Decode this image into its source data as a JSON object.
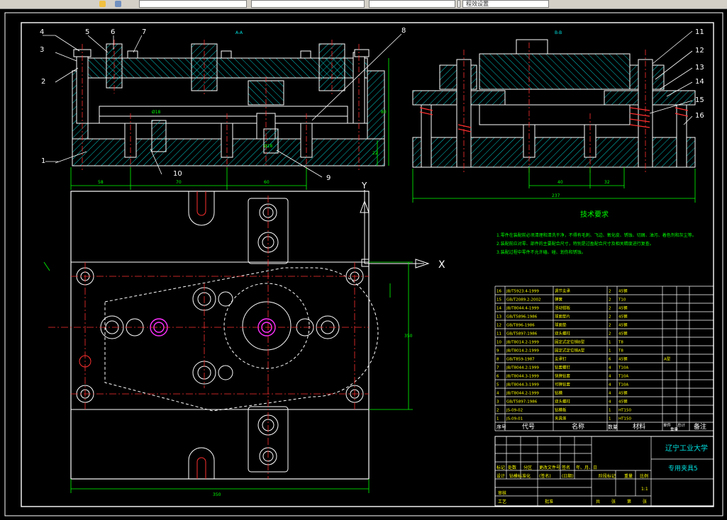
{
  "toolbar": {
    "fields": [
      "",
      "",
      "",
      "",
      "程效设置"
    ]
  },
  "drawing": {
    "section_a_label": "A-A",
    "section_b_label": "B-B",
    "part_callouts": [
      "1",
      "2",
      "3",
      "4",
      "5",
      "6",
      "7",
      "8",
      "9",
      "10",
      "11",
      "12",
      "13",
      "14",
      "15",
      "16"
    ],
    "dims": {
      "front_1": "58",
      "front_2": "70",
      "front_3": "60",
      "front_h1": "80",
      "front_h2": "22",
      "side_1": "40",
      "side_2": "32",
      "side_total": "237",
      "plan_total": "350",
      "plan_h": "350",
      "dia_1": "Ø18",
      "dia_2": "Ø18"
    },
    "axis_x": "X",
    "axis_y": "Y",
    "tech_title": "技术要求",
    "tech_notes": [
      "1.零件在装配前必须清理和清洗干净，不得有毛刺、飞边、氧化皮、锈蚀、切屑、油污、着色剂和灰尘等。",
      "2.装配前应对零、部件的主要配合尺寸，特别是过盈配合尺寸及相关精度进行复查。",
      "3.装配过程中零件不允许磕、碰、划伤和锈蚀。"
    ],
    "bom_rows": [
      [
        "16",
        "JB/T5923.4-1999",
        "调节支承",
        "2",
        "45钢",
        ""
      ],
      [
        "15",
        "GB/T2089.2-2002",
        "弹簧",
        "2",
        "T10",
        ""
      ],
      [
        "14",
        "JB/T8044.4-1999",
        "活动钳板",
        "2",
        "45钢",
        ""
      ],
      [
        "13",
        "GB/T5896-1986",
        "球面垫片",
        "2",
        "45钢",
        ""
      ],
      [
        "12",
        "GB/T896-1986",
        "球面垫",
        "2",
        "45钢",
        ""
      ],
      [
        "11",
        "GB/T5897-1986",
        "双头螺柱",
        "2",
        "45钢",
        ""
      ],
      [
        "10",
        "JB/T8014.2-1999",
        "固定式定位销B型",
        "1",
        "T8",
        ""
      ],
      [
        "9",
        "JB/T8014.2-1999",
        "固定式定位销A型",
        "1",
        "T8",
        ""
      ],
      [
        "8",
        "GB/T859-1987",
        "支承钉",
        "6",
        "45钢",
        "A型"
      ],
      [
        "7",
        "JB/T8044.2-1999",
        "钻套螺钉",
        "4",
        "T10A",
        ""
      ],
      [
        "6",
        "JB/T8044.3-1999",
        "快换钻套",
        "4",
        "T10A",
        ""
      ],
      [
        "5",
        "JB/T8044.3-1999",
        "可换钻套",
        "4",
        "T10A",
        ""
      ],
      [
        "4",
        "JB/T8044.2-1999",
        "钻模",
        "4",
        "45钢",
        ""
      ],
      [
        "3",
        "GB/T5897-1986",
        "双头螺柱",
        "4",
        "45钢",
        ""
      ],
      [
        "2",
        "JS-09-02",
        "钻模板",
        "1",
        "HT150",
        ""
      ],
      [
        "1",
        "JS-09-01",
        "夹具体",
        "1",
        "HT150",
        ""
      ]
    ],
    "bom_header": [
      "序号",
      "代号",
      "名称",
      "数量",
      "材料",
      "单件",
      "总计",
      "重量",
      "备注"
    ],
    "title_block": {
      "school": "辽宁工业大学",
      "drawing_name": "专用夹具5",
      "row_labels": [
        "标记",
        "处数",
        "分区",
        "更改文件号",
        "签名",
        "年、月、日"
      ],
      "design_row": [
        "设计",
        "钻模标准化",
        "(签名)",
        "(日期)"
      ],
      "stage_labels": [
        "阶段标记",
        "重量",
        "比例"
      ],
      "scale": "1:1",
      "review_labels": [
        "审核",
        "工艺"
      ],
      "approve_label": "批准",
      "sheet_labels": [
        "共",
        "张",
        "第",
        "张"
      ]
    }
  }
}
